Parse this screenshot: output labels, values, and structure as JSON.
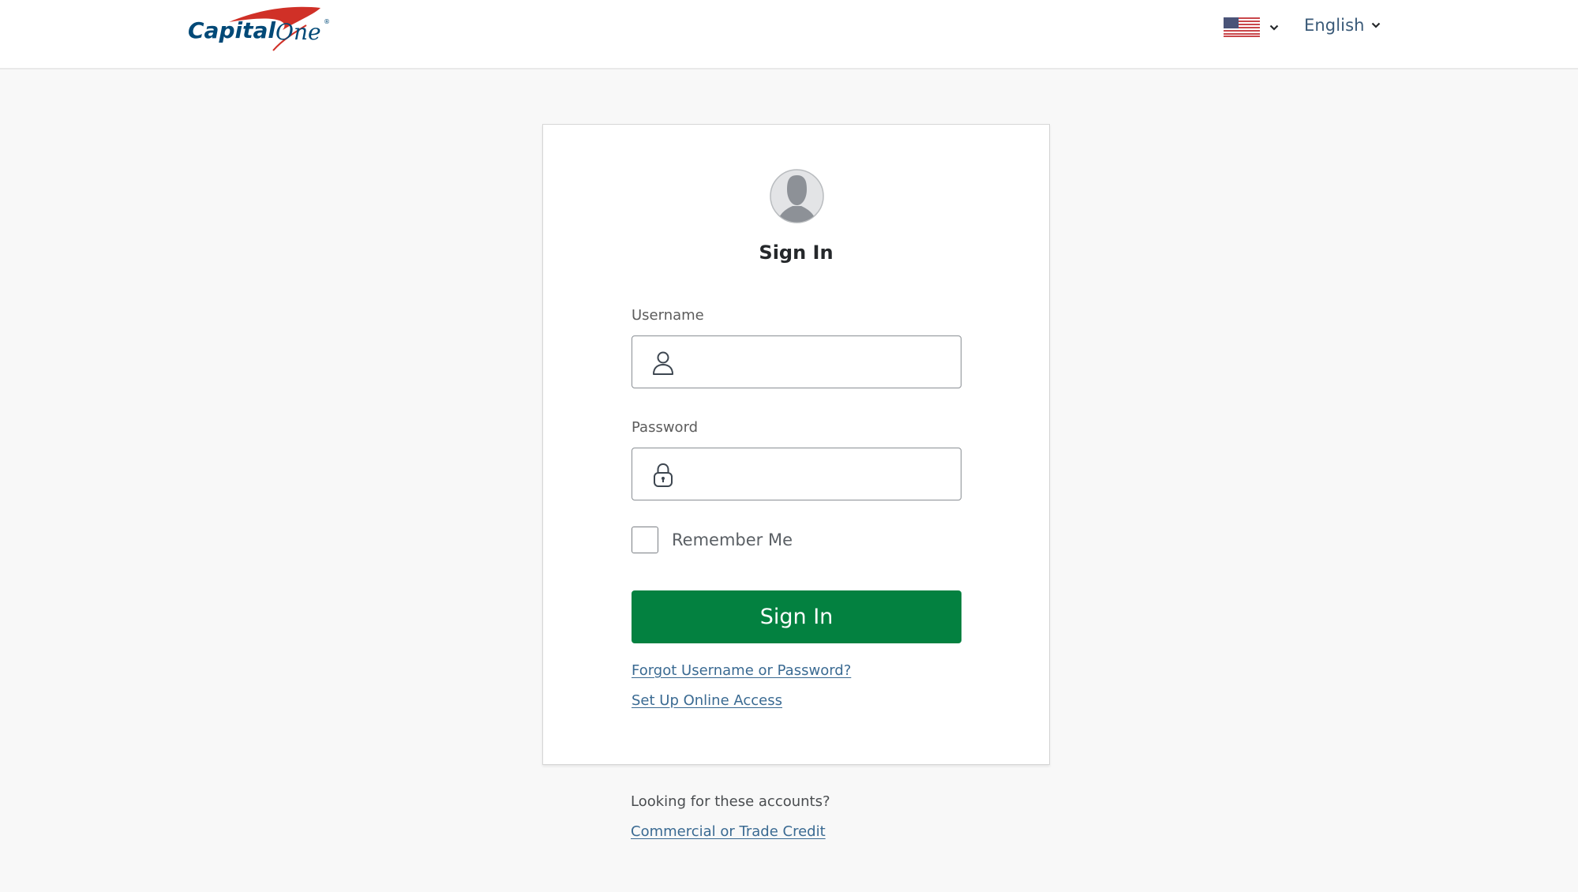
{
  "header": {
    "logo_text_primary": "Capital",
    "logo_text_secondary": "One",
    "logo_registered": "®",
    "country": {
      "icon": "us-flag-icon",
      "selected": "United States"
    },
    "language": {
      "selected": "English"
    }
  },
  "signin_card": {
    "avatar_icon": "user-avatar-icon",
    "title": "Sign In",
    "username": {
      "label": "Username",
      "value": "",
      "placeholder": "",
      "icon": "user-icon"
    },
    "password": {
      "label": "Password",
      "value": "",
      "placeholder": "",
      "icon": "lock-icon"
    },
    "remember_me": {
      "label": "Remember Me",
      "checked": false
    },
    "submit_label": "Sign In",
    "links": [
      {
        "label": "Forgot Username or Password?"
      },
      {
        "label": "Set Up Online Access"
      }
    ]
  },
  "footer": {
    "prompt": "Looking for these accounts?",
    "link_label": "Commercial or Trade Credit"
  },
  "colors": {
    "brand_navy": "#004977",
    "brand_red": "#d03027",
    "primary_button": "#038140",
    "link": "#3a6a92",
    "page_background": "#f8f8f8"
  }
}
